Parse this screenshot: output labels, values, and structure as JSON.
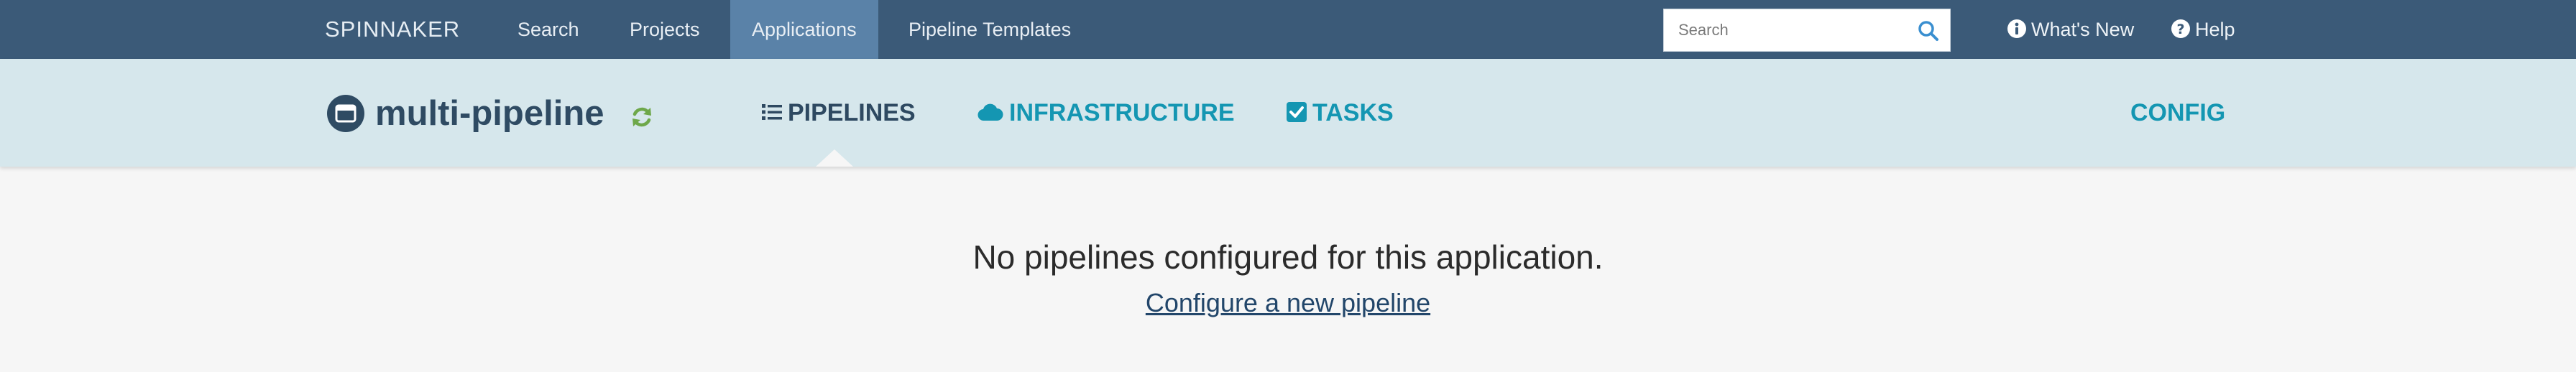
{
  "topnav": {
    "brand": "SPINNAKER",
    "links": [
      {
        "label": "Search"
      },
      {
        "label": "Projects"
      },
      {
        "label": "Applications",
        "active": true
      },
      {
        "label": "Pipeline Templates"
      }
    ],
    "search": {
      "placeholder": "Search",
      "value": "",
      "icon": "search-icon"
    },
    "whats_new": {
      "label": "What's New",
      "icon": "info-circle-icon"
    },
    "help": {
      "label": "Help",
      "icon": "question-circle-icon"
    }
  },
  "app_header": {
    "name": "multi-pipeline",
    "app_icon": "window-icon",
    "refresh_icon": "refresh-icon",
    "tabs": [
      {
        "label": "PIPELINES",
        "icon": "list-icon",
        "active": true
      },
      {
        "label": "INFRASTRUCTURE",
        "icon": "cloud-icon"
      },
      {
        "label": "TASKS",
        "icon": "check-square-icon"
      }
    ],
    "config_label": "CONFIG"
  },
  "main": {
    "empty_message": "No pipelines configured for this application.",
    "configure_link": "Configure a new pipeline"
  },
  "colors": {
    "topbar": "#3b5a78",
    "topbar_active": "#5a82a8",
    "appbar": "#d6e7ec",
    "accent_teal": "#1496b2",
    "refresh_green": "#6ea84a",
    "page_bg": "#f6f6f6"
  }
}
